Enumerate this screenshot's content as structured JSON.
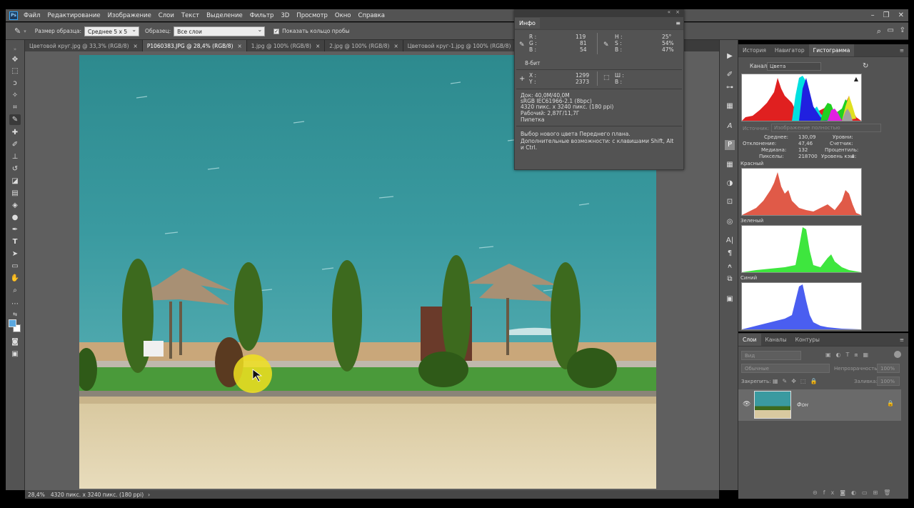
{
  "app": {
    "logo_text": "Ps"
  },
  "menu": [
    "Файл",
    "Редактирование",
    "Изображение",
    "Слои",
    "Текст",
    "Выделение",
    "Фильтр",
    "3D",
    "Просмотр",
    "Окно",
    "Справка"
  ],
  "window_controls": {
    "minimize": "–",
    "restore": "❐",
    "close": "✕"
  },
  "options": {
    "sample_size_label": "Размер образца:",
    "sample_size_value": "Среднее 5 x 5",
    "sample_label": "Образец:",
    "sample_value": "Все слои",
    "show_ring_label": "Показать кольцо пробы",
    "show_ring_checked": "✓"
  },
  "tabs": [
    {
      "label": "Цветовой круг.jpg @ 33,3% (RGB/8)",
      "close": "×"
    },
    {
      "label": "P1060383.JPG @ 28,4% (RGB/8)",
      "close": "×"
    },
    {
      "label": "1.jpg @ 100% (RGB/8)",
      "close": "×"
    },
    {
      "label": "2.jpg @ 100% (RGB/8)",
      "close": "×"
    },
    {
      "label": "Цветовой круг-1.jpg @ 100% (RGB/8)",
      "close": "×"
    }
  ],
  "status": {
    "zoom": "28,4%",
    "doc": "4320 пикс. x 3240 пикс. (180 ppi)",
    "arrow": "›"
  },
  "info": {
    "title": "Инфо",
    "R_label": "R :",
    "R": "119",
    "G_label": "G :",
    "G": "81",
    "B_label": "B :",
    "B": "54",
    "H_label": "H :",
    "H": "25°",
    "S_label": "S :",
    "S": "54%",
    "V_label": "B :",
    "V": "47%",
    "bit": "8-бит",
    "X_label": "X :",
    "X": "1299",
    "Y_label": "Y :",
    "Y": "2373",
    "W_label": "Ш :",
    "Hh_label": "В :",
    "doc_line1": "Док: 40,0M/40,0M",
    "doc_line2": "sRGB IEC61966-2.1 (8bpc)",
    "doc_line3": "4320 пикс. x 3240 пикс. (180 ppi)",
    "doc_line4": "Рабочий: 2,87Г/11,7Г",
    "doc_line5": "Пипетка",
    "hint": "Выбор нового цвета Переднего плана. Дополнительные возможности: с клавишами Shift, Alt и Ctrl."
  },
  "panel_tabs": [
    "История",
    "Навигатор",
    "Гистограмма"
  ],
  "histogram": {
    "channel_label": "Канал:",
    "channel_value": "Цвета",
    "source_label": "Источник:",
    "source_value": "Изображение полностью",
    "mean_label": "Среднее:",
    "mean": "130,09",
    "dev_label": "Отклонение:",
    "dev": "47,46",
    "median_label": "Медиана:",
    "median": "132",
    "pixels_label": "Пикселы:",
    "pixels": "218700",
    "levels_label": "Уровни:",
    "count_label": "Счетчик:",
    "percentile_label": "Процентиль:",
    "cache_label": "Уровень кэш:",
    "cache": "4",
    "red_label": "Красный",
    "green_label": "Зеленый",
    "blue_label": "Синий",
    "warn": "▲",
    "colors": {
      "red": "#e05a48",
      "green": "#3ee63e",
      "blue": "#4a5ef0"
    }
  },
  "layers": {
    "tabs": [
      "Слои",
      "Каналы",
      "Контуры"
    ],
    "search_placeholder": "Вид",
    "blend_mode": "Обычные",
    "opacity_label": "Непрозрачность:",
    "opacity": "100%",
    "lock_label": "Закрепить:",
    "fill_label": "Заливка:",
    "fill": "100%",
    "layer_name": "Фон"
  },
  "icons": {
    "eyedropper": "eyedropper-icon",
    "search": "search-icon",
    "workspace": "workspace-icon",
    "share": "share-icon",
    "eye": "eye-icon",
    "lock": "lock-icon",
    "refresh": "refresh-icon"
  }
}
